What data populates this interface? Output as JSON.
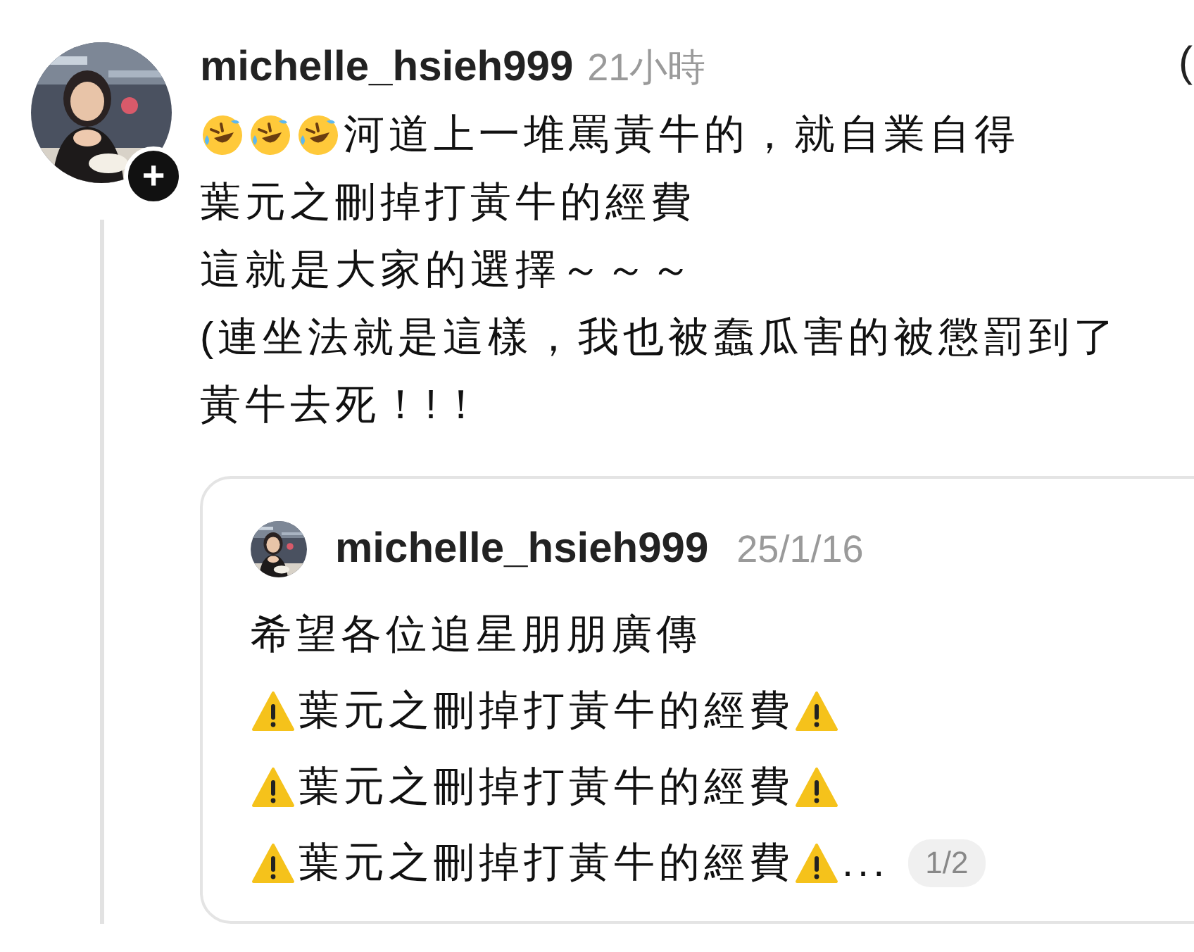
{
  "post": {
    "avatar": {
      "kind": "picture",
      "follow_badge": "+"
    },
    "username": "michelle_hsieh999",
    "time": "21小時",
    "edge_mark": "(",
    "lines": [
      [
        {
          "kind": "laugh-emoji"
        },
        {
          "kind": "laugh-emoji"
        },
        {
          "kind": "laugh-emoji"
        },
        {
          "kind": "text",
          "text": "河道上一堆罵黃牛的，就自業自得"
        }
      ],
      [
        {
          "kind": "text",
          "text": "葉元之刪掉打黃牛的經費"
        }
      ],
      [
        {
          "kind": "text",
          "text": "這就是大家的選擇～～～"
        }
      ],
      [
        {
          "kind": "text",
          "text": "(連坐法就是這樣，我也被蠢瓜害的被懲罰到了"
        }
      ],
      [
        {
          "kind": "text",
          "text": "黃牛去死！!！"
        }
      ]
    ]
  },
  "quoted_post": {
    "avatar": {
      "kind": "picture"
    },
    "username": "michelle_hsieh999",
    "time": "25/1/16",
    "lines": [
      [
        {
          "kind": "text",
          "text": "希望各位追星朋朋廣傳"
        }
      ],
      [
        {
          "kind": "warning-emoji"
        },
        {
          "kind": "text",
          "text": "葉元之刪掉打黃牛的經費"
        },
        {
          "kind": "warning-emoji"
        }
      ],
      [
        {
          "kind": "warning-emoji"
        },
        {
          "kind": "text",
          "text": "葉元之刪掉打黃牛的經費"
        },
        {
          "kind": "warning-emoji"
        }
      ],
      [
        {
          "kind": "warning-emoji"
        },
        {
          "kind": "text",
          "text": "葉元之刪掉打黃牛的經費"
        },
        {
          "kind": "warning-emoji"
        },
        {
          "kind": "text",
          "text": "..."
        }
      ]
    ],
    "page_indicator": "1/2"
  }
}
